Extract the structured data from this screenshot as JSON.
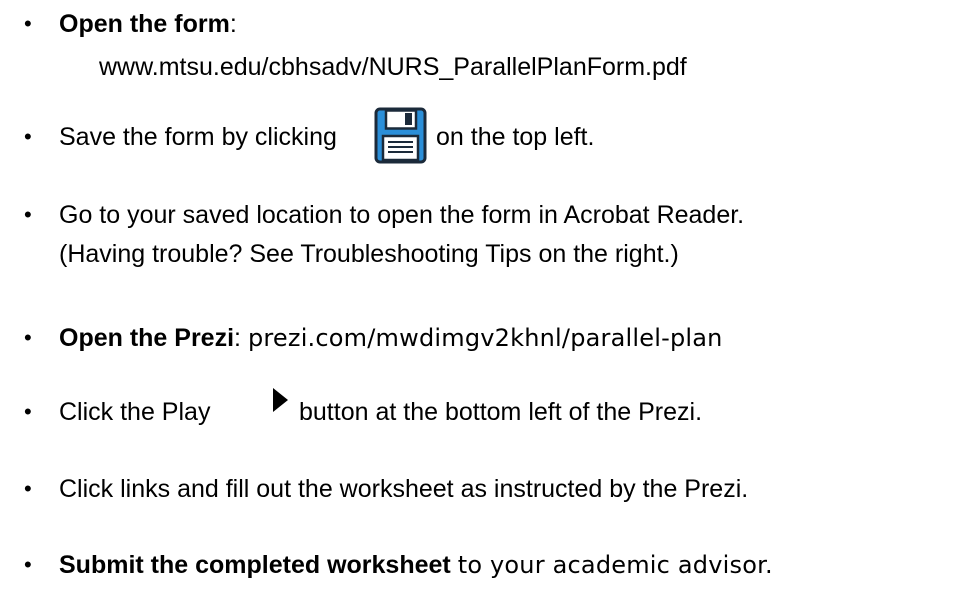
{
  "items": [
    {
      "bold": "Open the form",
      "text": ":"
    },
    {
      "url": "www.mtsu.edu/cbhsadv/NURS_ParallelPlanForm.pdf"
    },
    {
      "before": "Save the form by clicking",
      "after": "on the top left."
    },
    {
      "line1": "Go to your saved location to open the form in Acrobat Reader.",
      "line2": "(Having trouble? See Troubleshooting Tips on the right.)"
    },
    {
      "bold": "Open the Prezi",
      "colon": ":",
      "text": "prezi.com/mwdimgv2khnl/parallel-plan"
    },
    {
      "before": "Click the Play",
      "after": "button at the bottom left of the Prezi."
    },
    {
      "text": "Click links and fill out the worksheet as instructed by the Prezi."
    },
    {
      "bold": "Submit the completed worksheet",
      "text": "to your academic advisor."
    }
  ],
  "bullet_char": "•",
  "icons": {
    "save": "floppy-disk-save-icon",
    "play": "play-triangle-icon"
  },
  "colors": {
    "save_icon_blue": "#2b8fd9",
    "save_icon_dark": "#1b2a3a"
  }
}
